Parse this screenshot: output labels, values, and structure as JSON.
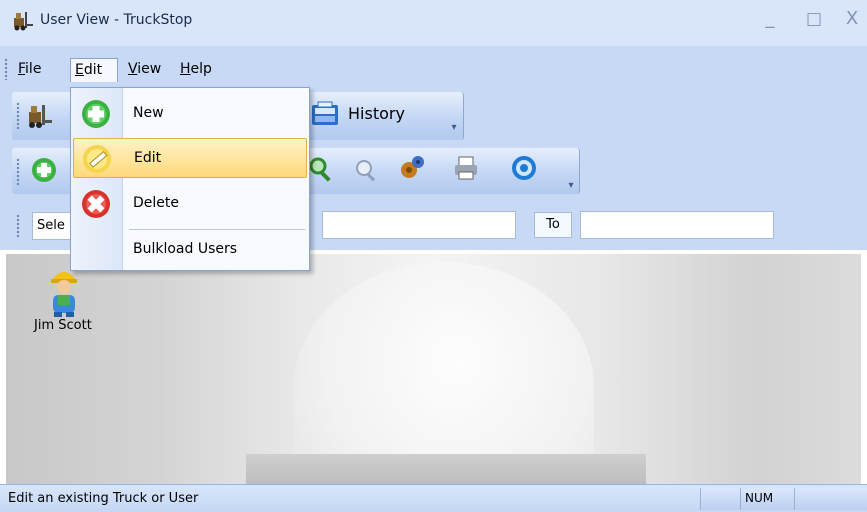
{
  "window": {
    "title": "User View - TruckStop",
    "app_icon": "forklift-icon",
    "controls": [
      "_",
      "□",
      "X"
    ]
  },
  "menubar": {
    "items": [
      {
        "label": "File",
        "accel": "F",
        "rest": "ile"
      },
      {
        "label": "Edit",
        "accel": "E",
        "rest": "dit"
      },
      {
        "label": "View",
        "accel": "V",
        "rest": "iew"
      },
      {
        "label": "Help",
        "accel": "H",
        "rest": "elp"
      }
    ],
    "open_menu": "Edit"
  },
  "edit_menu": {
    "items": [
      {
        "label": "New",
        "icon": "add-green-icon"
      },
      {
        "label": "Edit",
        "icon": "pencil-icon",
        "highlighted": true
      },
      {
        "label": "Delete",
        "icon": "delete-red-icon"
      },
      {
        "label": "Bulkload Users",
        "icon": ""
      }
    ]
  },
  "toolbar1": {
    "history_label": "History",
    "icons": [
      "forklift-icon",
      "history-icon"
    ]
  },
  "toolbar2": {
    "icons": [
      "add-icon",
      "search-icon",
      "search-small-icon",
      "gears-icon",
      "print-icon",
      "help-icon"
    ]
  },
  "filter": {
    "select_value": "Sele",
    "from_value": "",
    "to_label": "To",
    "to_value": ""
  },
  "content": {
    "users": [
      {
        "name": "Jim Scott",
        "icon": "worker-user-icon"
      }
    ]
  },
  "statusbar": {
    "text": "Edit an existing Truck or User",
    "num_indicator": "NUM"
  },
  "colors": {
    "chrome": "#c7d9f5",
    "title": "#d9e6fa",
    "highlight": "#ffd97a",
    "accent_green": "#3cb043",
    "accent_red": "#d8322d"
  }
}
